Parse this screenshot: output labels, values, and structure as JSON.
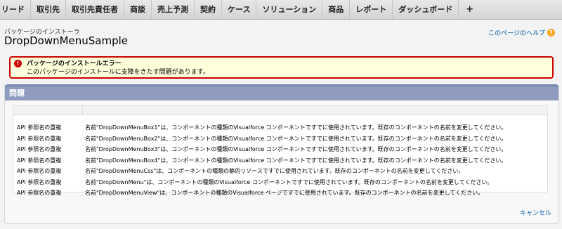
{
  "tabs": [
    "リード",
    "取引先",
    "取引先責任者",
    "商談",
    "売上予測",
    "契約",
    "ケース",
    "ソリューション",
    "商品",
    "レポート",
    "ダッシュボード",
    "+"
  ],
  "header": {
    "subtitle": "パッケージのインストーラ",
    "title": "DropDownMenuSample",
    "help_link": "このページのヘルプ",
    "help_icon": "?"
  },
  "error": {
    "icon": "!",
    "title": "パッケージのインストールエラー",
    "message": "このパッケージのインストールに支障をきたす問題があります。"
  },
  "problems": {
    "heading": "問題",
    "rows": [
      {
        "type": "API 参照名の重複",
        "message": "名前\"DropDownMenuBox1\"は、コンポーネントの種類のVisualforce コンポーネントですでに使用されています。既存のコンポーネントの名前を変更してください。"
      },
      {
        "type": "API 参照名の重複",
        "message": "名前\"DropDownMenuBox2\"は、コンポーネントの種類のVisualforce コンポーネントですでに使用されています。既存のコンポーネントの名前を変更してください。"
      },
      {
        "type": "API 参照名の重複",
        "message": "名前\"DropDownMenuBox3\"は、コンポーネントの種類のVisualforce コンポーネントですでに使用されています。既存のコンポーネントの名前を変更してください。"
      },
      {
        "type": "API 参照名の重複",
        "message": "名前\"DropDownMenuBox4\"は、コンポーネントの種類のVisualforce コンポーネントですでに使用されています。既存のコンポーネントの名前を変更してください。"
      },
      {
        "type": "API 参照名の重複",
        "message": "名前\"DropDownMenuCss\"は、コンポーネントの種類の静的リソースですでに使用されています。既存のコンポーネントの名前を変更してください。"
      },
      {
        "type": "API 参照名の重複",
        "message": "名前\"DropDownMenu\"は、コンポーネントの種類のVisualforce コンポーネントですでに使用されています。既存のコンポーネントの名前を変更してください。"
      },
      {
        "type": "API 参照名の重複",
        "message": "名前\"DropDownMenuView\"は、コンポーネントの種類のVisualforce ページですでに使用されています。既存のコンポーネントの名前を変更してください。"
      }
    ]
  },
  "actions": {
    "cancel": "キャンセル"
  }
}
